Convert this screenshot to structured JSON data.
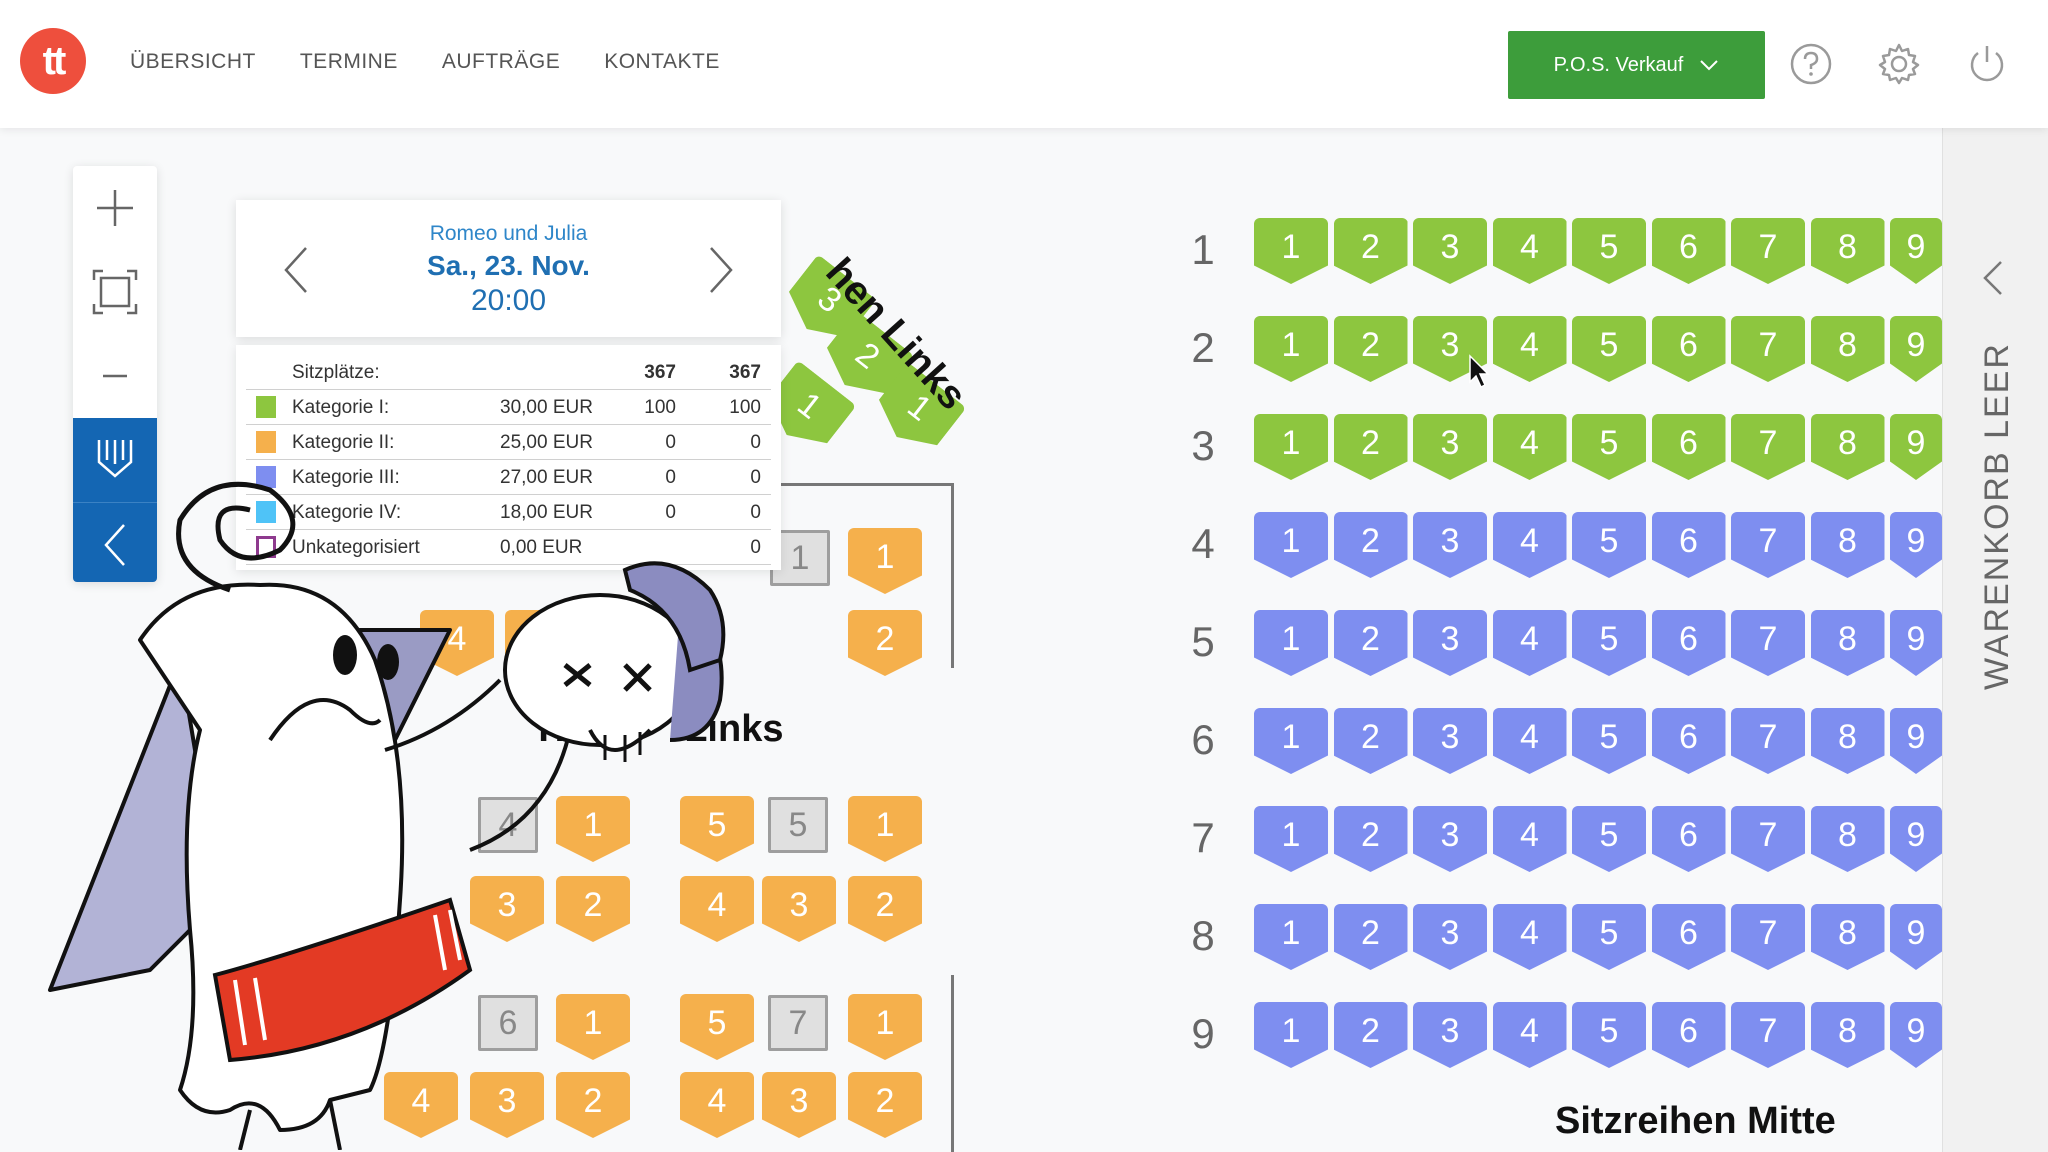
{
  "logo": {
    "text": "tt"
  },
  "nav": {
    "items": [
      "ÜBERSICHT",
      "TERMINE",
      "AUFTRÄGE",
      "KONTAKTE"
    ]
  },
  "pos_button": {
    "label": "P.O.S. Verkauf"
  },
  "event": {
    "title": "Romeo und Julia",
    "date": "Sa., 23. Nov.",
    "time": "20:00"
  },
  "price_table": {
    "header": {
      "label": "Sitzplätze:",
      "col1": "367",
      "col2": "367"
    },
    "rows": [
      {
        "name": "Kategorie I:",
        "price": "30,00 EUR",
        "c1": "100",
        "c2": "100",
        "color": "#8dc63f"
      },
      {
        "name": "Kategorie II:",
        "price": "25,00 EUR",
        "c1": "0",
        "c2": "0",
        "color": "#f5b04c"
      },
      {
        "name": "Kategorie III:",
        "price": "27,00 EUR",
        "c1": "0",
        "c2": "0",
        "color": "#7e8ef0"
      },
      {
        "name": "Kategorie IV:",
        "price": "18,00 EUR",
        "c1": "0",
        "c2": "0",
        "color": "#4fc3f7"
      },
      {
        "name": "Unkategorisiert",
        "price": "0,00 EUR",
        "c1": "",
        "c2": "0",
        "color": "#8e3a8e"
      }
    ]
  },
  "seat_map": {
    "rows": [
      "1",
      "2",
      "3",
      "4",
      "5",
      "6",
      "7",
      "8",
      "9"
    ],
    "seats": [
      "1",
      "2",
      "3",
      "4",
      "5",
      "6",
      "7",
      "8",
      "9"
    ],
    "green_rows": 3,
    "section_mitte": "Sitzreihen Mitte",
    "section_links": "hen Links",
    "section_tisch": "Tis",
    "section_tisch_tail": "Links",
    "diag_seats": [
      "3",
      "2",
      "1",
      "1"
    ],
    "tables": {
      "t1": [
        "1",
        "1",
        "2",
        "4",
        "3",
        "2"
      ],
      "t4": [
        "4",
        "1",
        "3",
        "2"
      ],
      "t5": [
        "5",
        "5",
        "1",
        "4",
        "3",
        "2"
      ],
      "t6": [
        "6",
        "1",
        "4",
        "3",
        "2"
      ],
      "t7": [
        "5",
        "7",
        "1",
        "4",
        "3",
        "2"
      ]
    }
  },
  "cart": {
    "label": "WARENKORB LEER"
  },
  "colors": {
    "accent": "#1466b3",
    "pos_green": "#3d9d3b",
    "logo": "#ee4f3d"
  }
}
